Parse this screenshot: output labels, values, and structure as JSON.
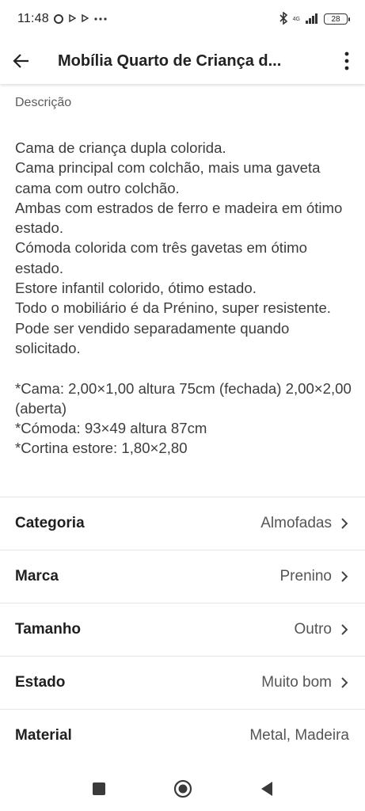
{
  "status_bar": {
    "time": "11:48",
    "network_label": "4G",
    "battery": "28"
  },
  "app_bar": {
    "title": "Mobília Quarto de Criança d..."
  },
  "description": {
    "label": "Descrição",
    "text": "Cama de criança dupla colorida.\nCama principal com colchão, mais uma gaveta cama com outro colchão.\nAmbas com estrados de ferro e madeira em ótimo estado.\nCómoda colorida com três gavetas em ótimo estado.\nEstore infantil colorido, ótimo estado.\nTodo o mobiliário é da Prénino, super resistente.\nPode ser vendido separadamente quando solicitado.\n\n*Cama: 2,00×1,00 altura 75cm (fechada) 2,00×2,00 (aberta)\n*Cómoda: 93×49 altura 87cm\n*Cortina estore: 1,80×2,80"
  },
  "attributes": [
    {
      "label": "Categoria",
      "value": "Almofadas"
    },
    {
      "label": "Marca",
      "value": "Prenino"
    },
    {
      "label": "Tamanho",
      "value": "Outro"
    },
    {
      "label": "Estado",
      "value": "Muito bom"
    },
    {
      "label": "Material",
      "value": "Metal, Madeira"
    }
  ]
}
